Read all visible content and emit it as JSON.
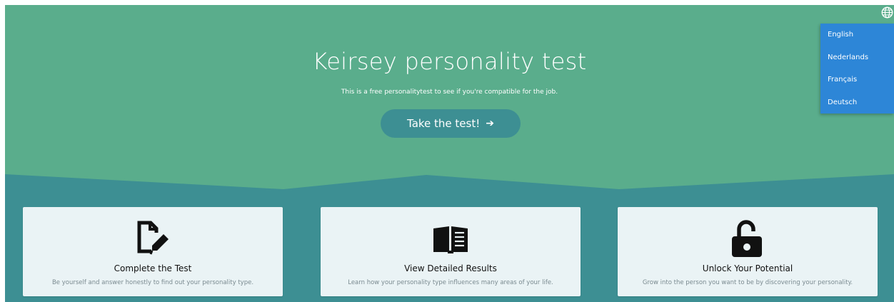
{
  "hero": {
    "title": "Keirsey personality test",
    "subtitle": "This is a free personalitytest to see if you're compatible for the job.",
    "cta_label": "Take the test!",
    "cta_icon": "arrow-right-icon"
  },
  "language_menu": {
    "toggle_icon": "globe-icon",
    "items": [
      {
        "label": "English"
      },
      {
        "label": "Nederlands"
      },
      {
        "label": "Français"
      },
      {
        "label": "Deutsch"
      }
    ]
  },
  "features": [
    {
      "icon": "edit-document-icon",
      "title": "Complete the Test",
      "description": "Be yourself and answer honestly to find out your personality type."
    },
    {
      "icon": "open-book-icon",
      "title": "View Detailed Results",
      "description": "Learn how your personality type influences many areas of your life."
    },
    {
      "icon": "unlocked-padlock-icon",
      "title": "Unlock Your Potential",
      "description": "Grow into the person you want to be by discovering your personality."
    }
  ],
  "colors": {
    "hero_green": "#5aad8c",
    "lower_teal": "#3d8f93",
    "menu_blue": "#2d86d7",
    "card_bg": "#eaf3f5"
  }
}
